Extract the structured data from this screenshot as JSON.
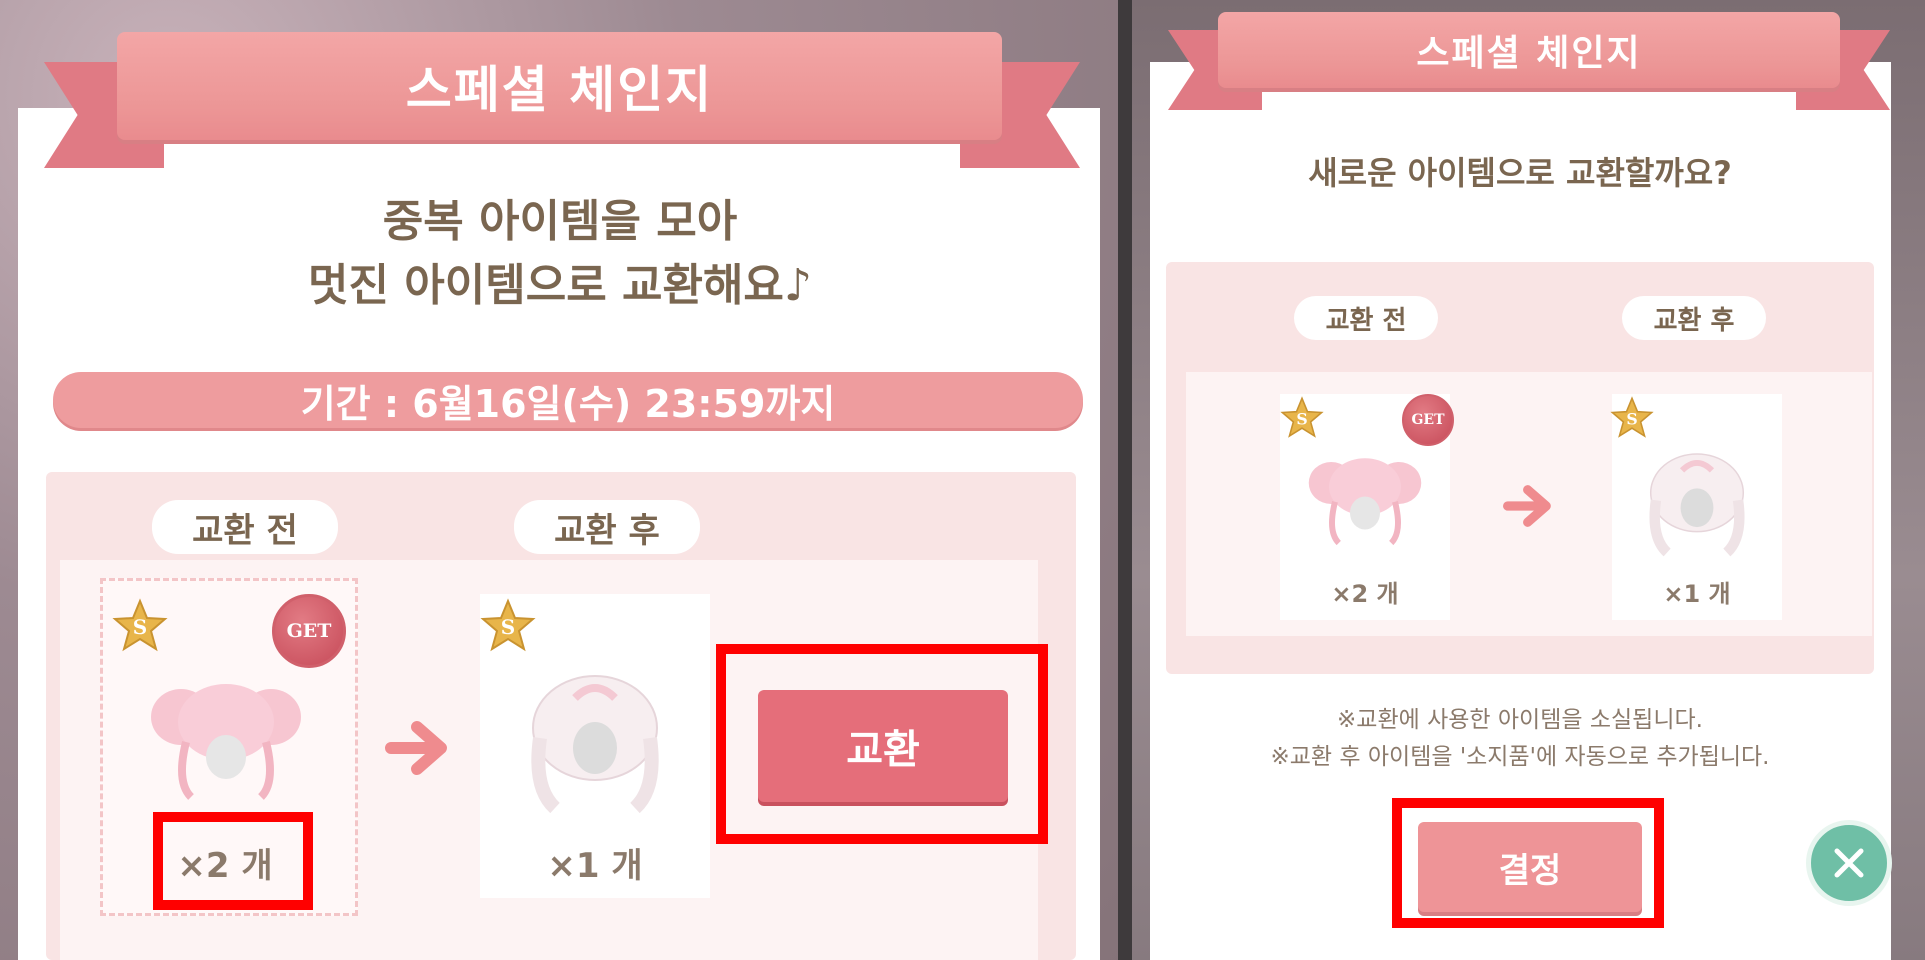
{
  "left_dialog": {
    "title": "스페셜 체인지",
    "heading_line1": "중복 아이템을 모아",
    "heading_line2": "멋진 아이템으로 교환해요♪",
    "period": "기간 : 6월16일(수) 23:59까지",
    "before_label": "교환 전",
    "after_label": "교환 후",
    "before_qty": "×2 개",
    "after_qty": "×1 개",
    "get_badge": "GET",
    "rank_badge": "S",
    "exchange_button": "교환"
  },
  "right_dialog": {
    "title": "스페셜 체인지",
    "question": "새로운 아이템으로 교환할까요?",
    "before_label": "교환 전",
    "after_label": "교환 후",
    "before_qty": "×2 개",
    "after_qty": "×1 개",
    "get_badge": "GET",
    "rank_badge": "S",
    "note_line1": "※교환에 사용한 아이템을 소실됩니다.",
    "note_line2": "※교환 후 아이템을 '소지품'에 자동으로 추가됩니다.",
    "confirm_button": "결정"
  },
  "colors": {
    "ribbon": "#ec9696",
    "exchange_button": "#e56e7a",
    "confirm_button": "#ee9497",
    "highlight_box": "#ff0000",
    "close_button": "#6fbfa6",
    "heading_text": "#7a6650"
  },
  "icons": {
    "star": "star-s-icon",
    "get": "get-badge-icon",
    "arrow": "arrow-right-icon",
    "close": "close-icon",
    "item": "pink-hair-icon"
  }
}
